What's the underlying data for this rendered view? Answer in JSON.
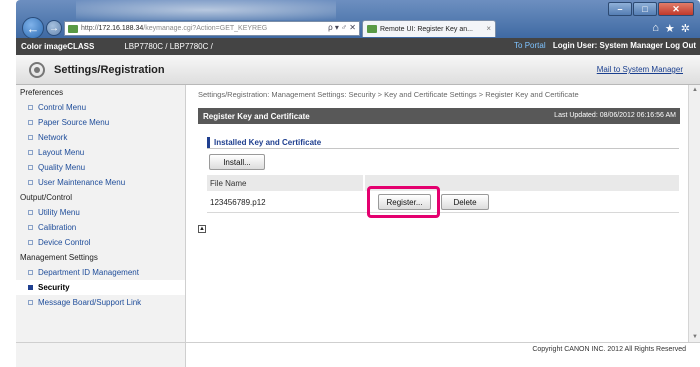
{
  "browser": {
    "url_prefix": "http://",
    "url_host": "172.16.188.34",
    "url_path": "/keymanage.cgi?Action=GET_KEYREG",
    "address_tools": "ρ ▾ ♂ ✕",
    "tab_title": "Remote UI: Register Key an...",
    "tab_close": "×",
    "win_min": "–",
    "win_max": "□",
    "win_close": "✕",
    "icon_home": "⌂",
    "icon_star": "★",
    "icon_gear": "✲"
  },
  "app": {
    "product": "Color imageCLASS",
    "model": "LBP7780C / LBP7780C /",
    "portal_link": "To Portal",
    "login_label": "Login User: System Manager Log Out",
    "page_title": "Settings/Registration",
    "mail_link": "Mail to System Manager"
  },
  "sidebar": {
    "sections": [
      {
        "label": "Preferences",
        "items": [
          "Control Menu",
          "Paper Source Menu",
          "Network",
          "Layout Menu",
          "Quality Menu",
          "User Maintenance Menu"
        ]
      },
      {
        "label": "Output/Control",
        "items": [
          "Utility Menu",
          "Calibration",
          "Device Control"
        ]
      },
      {
        "label": "Management Settings",
        "items": [
          "Department ID Management",
          "Security",
          "Message Board/Support Link"
        ]
      }
    ],
    "active_item": "Security"
  },
  "main": {
    "breadcrumb": "Settings/Registration: Management Settings: Security > Key and Certificate Settings > Register Key and Certificate",
    "panel_title": "Register Key and Certificate",
    "last_updated": "Last Updated: 08/06/2012 06:16:56 AM",
    "section_title": "Installed Key and Certificate",
    "install_button": "Install...",
    "column_file_name": "File Name",
    "file_name": "123456789.p12",
    "register_button": "Register...",
    "delete_button": "Delete",
    "to_top": "▲"
  },
  "footer": {
    "copyright": "Copyright CANON INC. 2012 All Rights Reserved"
  },
  "colors": {
    "highlight": "#e4006f",
    "header_bar": "#444444",
    "panel_bar": "#585858",
    "link": "#1f4d9a"
  }
}
